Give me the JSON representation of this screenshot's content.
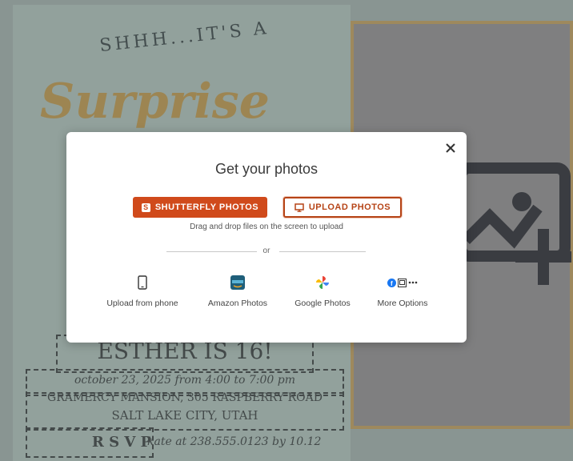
{
  "background_card": {
    "headline_top": "SHHH...IT'S A",
    "headline_script": "Surprise",
    "name_line": "ESTHER IS 16!",
    "date_line": "october 23, 2025 from 4:00 to 7:00 pm",
    "address_line1": "GRAMERCY MANSION, 305 RASPBERRY ROAD",
    "address_line2": "SALT LAKE CITY, UTAH",
    "rsvp": "R S V P",
    "rsvp_detail": "kate at 238.555.0123 by 10.12"
  },
  "modal": {
    "title": "Get your photos",
    "close_icon": "close-icon",
    "shutterfly_button": "SHUTTERFLY PHOTOS",
    "shutterfly_badge": "S",
    "upload_button": "UPLOAD PHOTOS",
    "drag_hint": "Drag and drop files on the screen to upload",
    "or_text": "or",
    "options": [
      {
        "label": "Upload from phone",
        "icon": "phone-icon"
      },
      {
        "label": "Amazon Photos",
        "icon": "amazon-photos-icon"
      },
      {
        "label": "Google Photos",
        "icon": "google-photos-icon"
      },
      {
        "label": "More Options",
        "icon": "more-options-icon"
      }
    ]
  },
  "colors": {
    "shutterfly_orange": "#d04a1b",
    "card_mint": "#a4b9b2",
    "gold": "#b3934f"
  }
}
